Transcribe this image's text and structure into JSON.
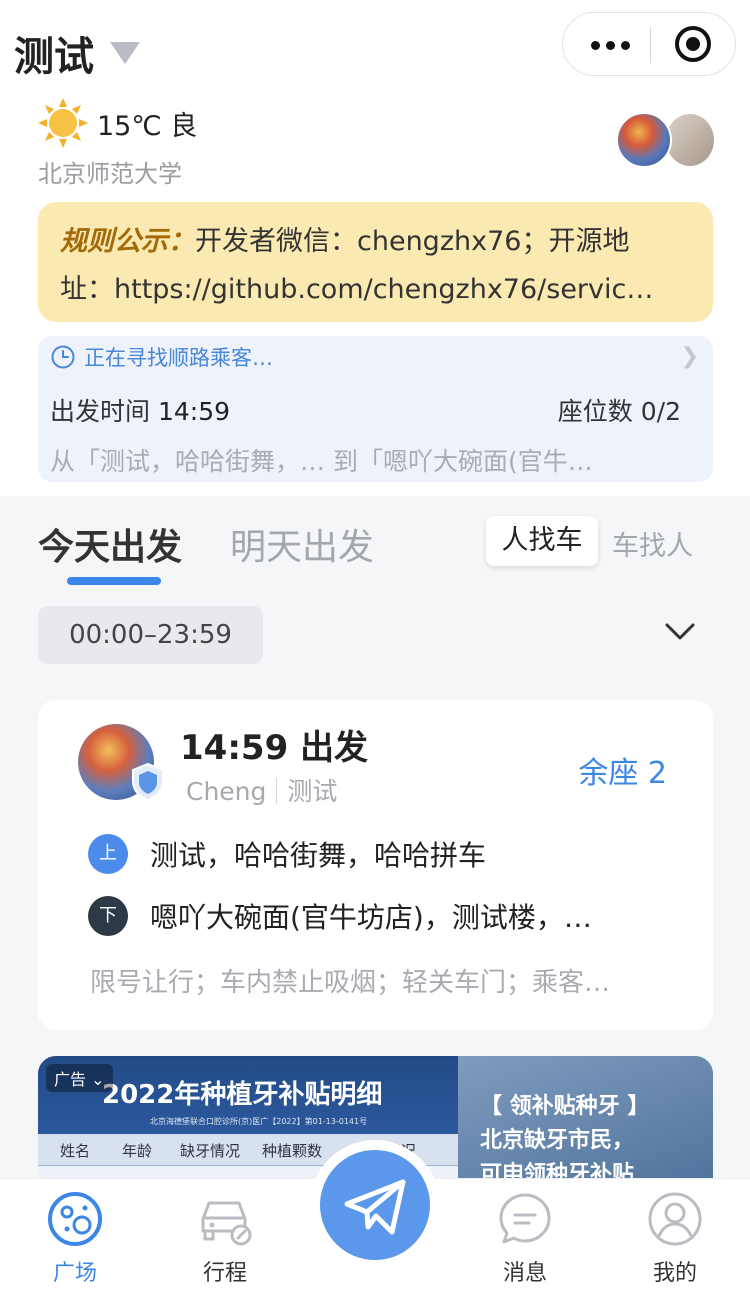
{
  "header": {
    "title": "测试"
  },
  "weather": {
    "text": "15℃ 良",
    "location": "北京师范大学"
  },
  "notice": {
    "label": "规则公示：",
    "line1": "开发者微信：chengzhx76；开源地",
    "line2": "址：https://github.com/chengzhx76/servic…"
  },
  "trip": {
    "status": "正在寻找顺路乘客…",
    "time_label": "出发时间",
    "time_value": "14:59",
    "seats_label": "座位数",
    "seats_value": "0/2",
    "route": "从「测试，哈哈街舞，… 到「嗯吖大碗面(官牛…"
  },
  "tabs": {
    "today": "今天出发",
    "tomorrow": "明天出发",
    "mode_active": "人找车",
    "mode_inactive": "车找人"
  },
  "filter": {
    "time_range": "00:00–23:59"
  },
  "ride": {
    "time": "14:59 出发",
    "user": "Cheng",
    "tag": "测试",
    "seats_left": "余座 2",
    "up_badge": "上",
    "up_text": "测试，哈哈街舞，哈哈拼车",
    "down_badge": "下",
    "down_text": "嗯吖大碗面(官牛坊店)，测试楼，…",
    "notes": "限号让行；车内禁止吸烟；轻关车门；乘客…"
  },
  "ad": {
    "badge": "广告 ⌄",
    "title": "2022年种植牙补贴明细",
    "sub": "北京海德堡联合口腔诊所(京)医广【2022】第01-13-0141号",
    "cols": [
      "姓名",
      "年龄",
      "缺牙情况",
      "种植颗数",
      "情况"
    ],
    "r1": "【 领补贴种牙 】",
    "r2": "北京缺牙市民，",
    "r3": "可申领种牙补贴"
  },
  "tabbar": [
    {
      "label": "广场",
      "icon": "planet-icon"
    },
    {
      "label": "行程",
      "icon": "car-icon"
    },
    {
      "label": "",
      "icon": "paper-plane-icon"
    },
    {
      "label": "消息",
      "icon": "chat-bubble-icon"
    },
    {
      "label": "我的",
      "icon": "user-icon"
    }
  ],
  "colors": {
    "accent": "#3c86e6",
    "notice_bg": "#faeab2",
    "notice_label": "#a46a0a",
    "trip_bg": "#edf2fb"
  }
}
